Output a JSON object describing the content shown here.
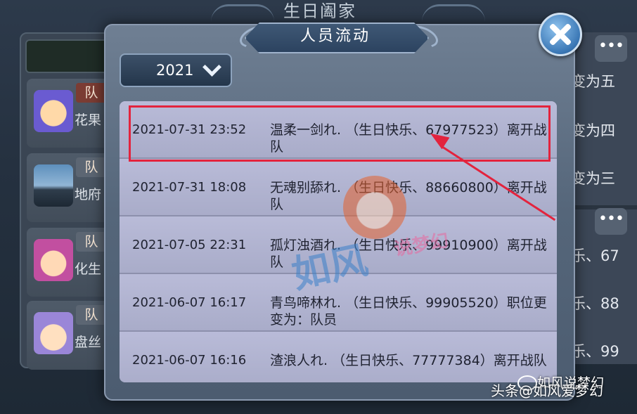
{
  "background": {
    "title": "生日阖家",
    "members": [
      {
        "badge": "队",
        "name": "花果"
      },
      {
        "badge": "队",
        "name": "地府"
      },
      {
        "badge": "队",
        "name": "化生"
      },
      {
        "badge": "队",
        "name": "盘丝"
      }
    ],
    "right_texts": [
      "变为五",
      "变为四",
      "变为三",
      "乐、67",
      "乐、88",
      "乐、99"
    ],
    "dots_label": "•••"
  },
  "popup": {
    "title": "人员流动",
    "year_select": {
      "value": "2021"
    },
    "records": [
      {
        "datetime": "2021-07-31 23:52",
        "message": "温柔一剑れ.  （生日快乐、67977523）离开战队"
      },
      {
        "datetime": "2021-07-31 18:08",
        "message": "无魂别舔れ.  （生日快乐、88660800）离开战队"
      },
      {
        "datetime": "2021-07-05 22:31",
        "message": "孤灯浊酒れ.  （生日快乐、99910900）离开战队"
      },
      {
        "datetime": "2021-06-07 16:17",
        "message": "青鸟啼林れ.  （生日快乐、99905520）职位更变为：队员"
      },
      {
        "datetime": "2021-06-07 16:16",
        "message": "渣浪人れ.  （生日快乐、77777384）离开战队"
      }
    ]
  },
  "watermark": {
    "main": "如风",
    "sub": "说梦幻"
  },
  "footer": {
    "source": "头条",
    "author": "@如风爱梦幻",
    "wechat": "如风说梦幻"
  },
  "colors": {
    "highlight": "#e3233d",
    "accent_blue": "#3a77b5"
  }
}
